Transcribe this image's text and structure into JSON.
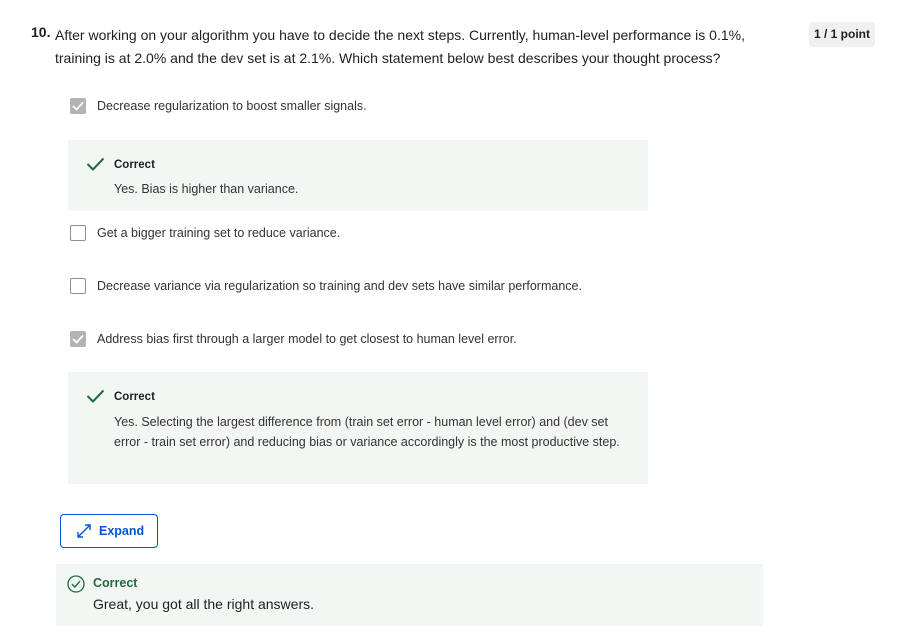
{
  "question": {
    "number": "10.",
    "text": "After working on your algorithm you have to decide the next steps. Currently, human-level performance is 0.1%, training is at 2.0% and the dev set is at 2.1%. Which statement below best describes your thought process?",
    "points": "1 / 1 point"
  },
  "options": [
    {
      "label": "Decrease regularization to boost smaller signals.",
      "checked": true
    },
    {
      "label": "Get a bigger training set to reduce variance.",
      "checked": false
    },
    {
      "label": "Decrease variance via regularization so training and dev sets have similar performance.",
      "checked": false
    },
    {
      "label": "Address bias first through a larger model to get closest to human level error.",
      "checked": true
    }
  ],
  "feedback": [
    {
      "title": "Correct",
      "text": "Yes. Bias is higher than variance."
    },
    {
      "title": "Correct",
      "text": "Yes. Selecting the largest difference from (train set error - human level error) and (dev set error - train set error) and reducing bias or variance accordingly is the most productive step."
    }
  ],
  "expand_label": "Expand",
  "result": {
    "title": "Correct",
    "text": "Great, you got all the right answers."
  },
  "colors": {
    "accent_blue": "#0056d2",
    "success_green": "#1e6b3d",
    "feedback_bg": "#f2f7f4",
    "checked_box": "#b3b3b3"
  }
}
